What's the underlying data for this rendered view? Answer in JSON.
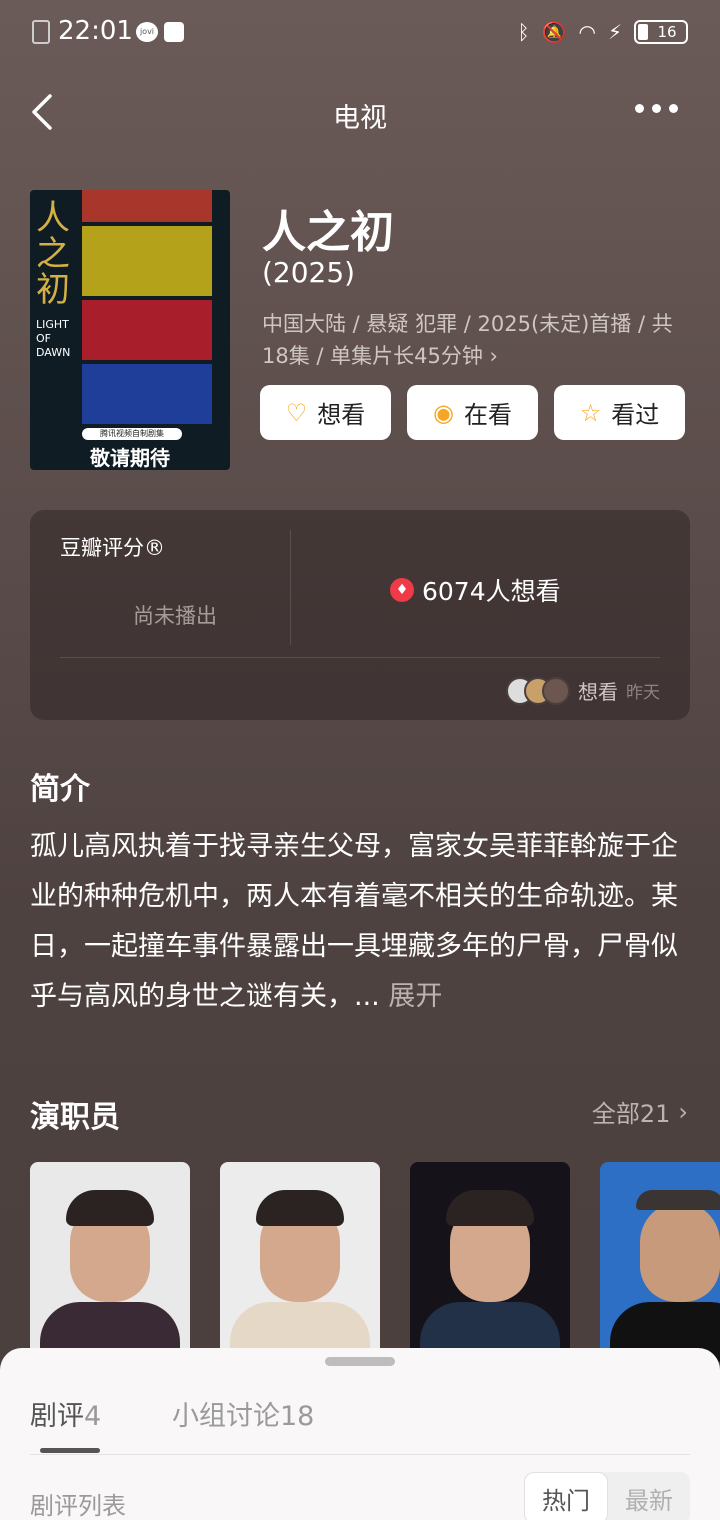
{
  "status_bar": {
    "time": "22:01",
    "battery": "16"
  },
  "nav": {
    "title": "电视"
  },
  "movie": {
    "title": "人之初",
    "year": "(2025)",
    "meta": "中国大陆 / 悬疑 犯罪 / 2025(未定)首播 / 共18集 / 单集片长45分钟 ›",
    "poster": {
      "calligraphy": "人之初",
      "english": "LIGHT OF DAWN",
      "badge": "腾讯视频自制剧集",
      "caption": "敬请期待"
    }
  },
  "actions": [
    {
      "label": "想看",
      "icon": "heart-plus-icon"
    },
    {
      "label": "在看",
      "icon": "target-icon"
    },
    {
      "label": "看过",
      "icon": "star-icon"
    }
  ],
  "rating": {
    "label": "豆瓣评分®",
    "status": "尚未播出",
    "want_count": "6074人想看",
    "recent_action": "想看",
    "recent_time": "昨天"
  },
  "synopsis": {
    "title": "简介",
    "text": "孤儿高风执着于找寻亲生父母，富家女吴菲菲斡旋于企业的种种危机中，两人本有着毫不相关的生命轨迹。某日，一起撞车事件暴露出一具埋藏多年的尸骨，尸骨似乎与高风的身世之谜有关，...",
    "expand": "展开"
  },
  "cast": {
    "title": "演职员",
    "all": "全部21"
  },
  "sheet": {
    "tabs": [
      {
        "label": "剧评",
        "count": "4"
      },
      {
        "label": "小组讨论",
        "count": "18"
      }
    ],
    "list_label": "剧评列表",
    "sort": [
      "热门",
      "最新"
    ]
  },
  "colors": {
    "accent": "#f5a623",
    "fire": "#ee3b47",
    "sheet_bg": "#f9f7f7"
  }
}
